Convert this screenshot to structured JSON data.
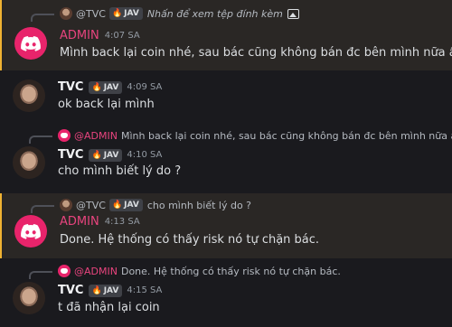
{
  "tag_label": "JAV",
  "colors": {
    "accent_admin": "#e8447e",
    "highlight_bar": "#f0b232",
    "discord_pink": "#e8246b"
  },
  "messages": [
    {
      "reply": {
        "author": "@TVC",
        "text": "Nhấn để xem tệp đính kèm",
        "has_image_icon": true
      },
      "author": "ADMIN",
      "time": "4:07 SA",
      "text": "Mình back lại coin nhé, sau bác cũng không bán đc bên mình nữa ấy"
    },
    {
      "author": "TVC",
      "time": "4:09 SA",
      "text": "ok back lại mình"
    },
    {
      "reply": {
        "author": "@ADMIN",
        "text": "Mình back lại coin nhé, sau bác cũng không bán đc bên mình nữa ấy"
      },
      "author": "TVC",
      "time": "4:10 SA",
      "text": "cho mình biết lý do ?"
    },
    {
      "reply": {
        "author": "@TVC",
        "text": "cho mình biết lý do ?"
      },
      "author": "ADMIN",
      "time": "4:13 SA",
      "text": "Done. Hệ thống có thấy risk nó tự chặn bác."
    },
    {
      "reply": {
        "author": "@ADMIN",
        "text": "Done. Hệ thống có thấy risk nó tự chặn bác."
      },
      "author": "TVC",
      "time": "4:15 SA",
      "text": "t đã nhận lại coin"
    }
  ]
}
